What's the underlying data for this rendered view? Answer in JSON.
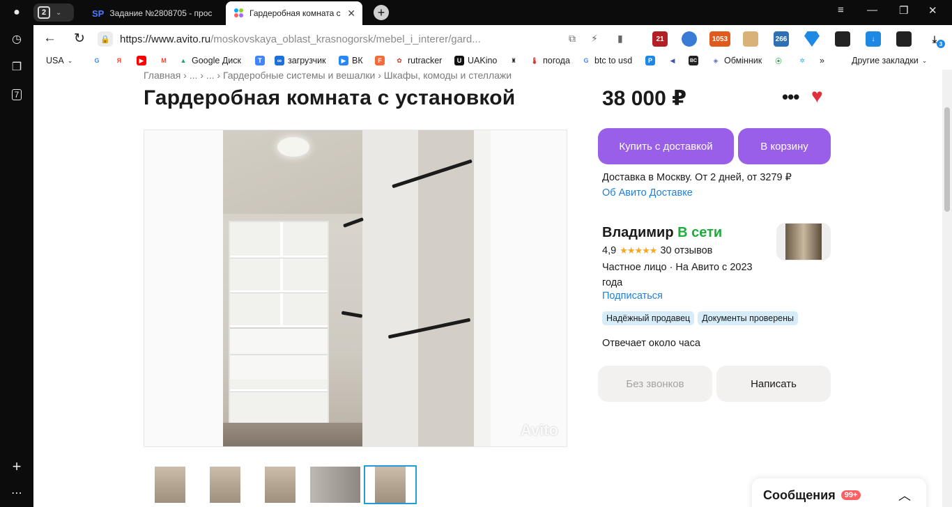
{
  "browser": {
    "tab_count": "2",
    "tabs": [
      {
        "favicon": "SP",
        "title": "Задание №2808705 - прос"
      },
      {
        "favicon": "avito-icon",
        "title": "Гардеробная комната с"
      }
    ],
    "address": {
      "host": "https://www.avito.ru",
      "path": "/moskovskaya_oblast_krasnogorsk/mebel_i_interer/gard..."
    },
    "extensions": [
      {
        "label": "21",
        "color": "#b31f24"
      },
      {
        "label": "",
        "color": "#3a7bd5"
      },
      {
        "label": "1053",
        "color": "#e05a1e"
      },
      {
        "label": "",
        "color": "#d9b27a"
      },
      {
        "label": "266",
        "color": "#2f6fb3"
      },
      {
        "label": "",
        "color": "#1e88e5"
      },
      {
        "label": "",
        "color": "#222222"
      },
      {
        "label": "",
        "color": "#1e88e5"
      },
      {
        "label": "",
        "color": "#222222"
      }
    ],
    "download_badge": "3",
    "bookmarks": [
      {
        "label": "USA",
        "icon": ""
      },
      {
        "label": "",
        "icon": "G"
      },
      {
        "label": "",
        "icon": "Я"
      },
      {
        "label": "",
        "icon": "▶"
      },
      {
        "label": "",
        "icon": "M"
      },
      {
        "label": "Google Диск",
        "icon": "▲"
      },
      {
        "label": "",
        "icon": "T"
      },
      {
        "label": "загрузчик",
        "icon": "∞"
      },
      {
        "label": "ВК",
        "icon": "▶"
      },
      {
        "label": "",
        "icon": "F"
      },
      {
        "label": "rutracker",
        "icon": "✿"
      },
      {
        "label": "UAKino",
        "icon": "U"
      },
      {
        "label": "",
        "icon": "♜"
      },
      {
        "label": "погода",
        "icon": "🌡"
      },
      {
        "label": "btc to usd",
        "icon": "G"
      },
      {
        "label": "",
        "icon": "P"
      },
      {
        "label": "",
        "icon": "◀"
      },
      {
        "label": "",
        "icon": "BC"
      },
      {
        "label": "Обмінник",
        "icon": "◈"
      },
      {
        "label": "",
        "icon": "⦿"
      },
      {
        "label": "",
        "icon": "✲"
      },
      {
        "label": "Другие закладки",
        "icon": ""
      }
    ]
  },
  "page": {
    "breadcrumb": "Главная  ›  ...  ›  ...  ›  Гардеробные системы и вешалки  ›  Шкафы, комоды и стеллажи",
    "title": "Гардеробная комната с установкой",
    "price": "38 000 ₽",
    "watermark": "Avito",
    "buy_button": "Купить с доставкой",
    "cart_button": "В корзину",
    "delivery_text": "Доставка в Москву. От 2 дней, от 3279 ₽",
    "delivery_link": "Об Авито Доставке",
    "seller": {
      "name": "Владимир",
      "online": "В сети",
      "rating": "4,9",
      "stars": "★★★★★",
      "reviews": "30 отзывов",
      "info": "Частное лицо · На Авито с 2023 года",
      "subscribe": "Подписаться"
    },
    "badges": [
      "Надёжный продавец",
      "Документы проверены"
    ],
    "response_time": "Отвечает около часа",
    "no_calls_button": "Без звонков",
    "write_button": "Написать",
    "messages": {
      "label": "Сообщения",
      "count": "99+"
    }
  },
  "colors": {
    "accent": "#9a5fe8",
    "link": "#1e7fd9",
    "online": "#1aad3c",
    "heart": "#e1303b"
  }
}
